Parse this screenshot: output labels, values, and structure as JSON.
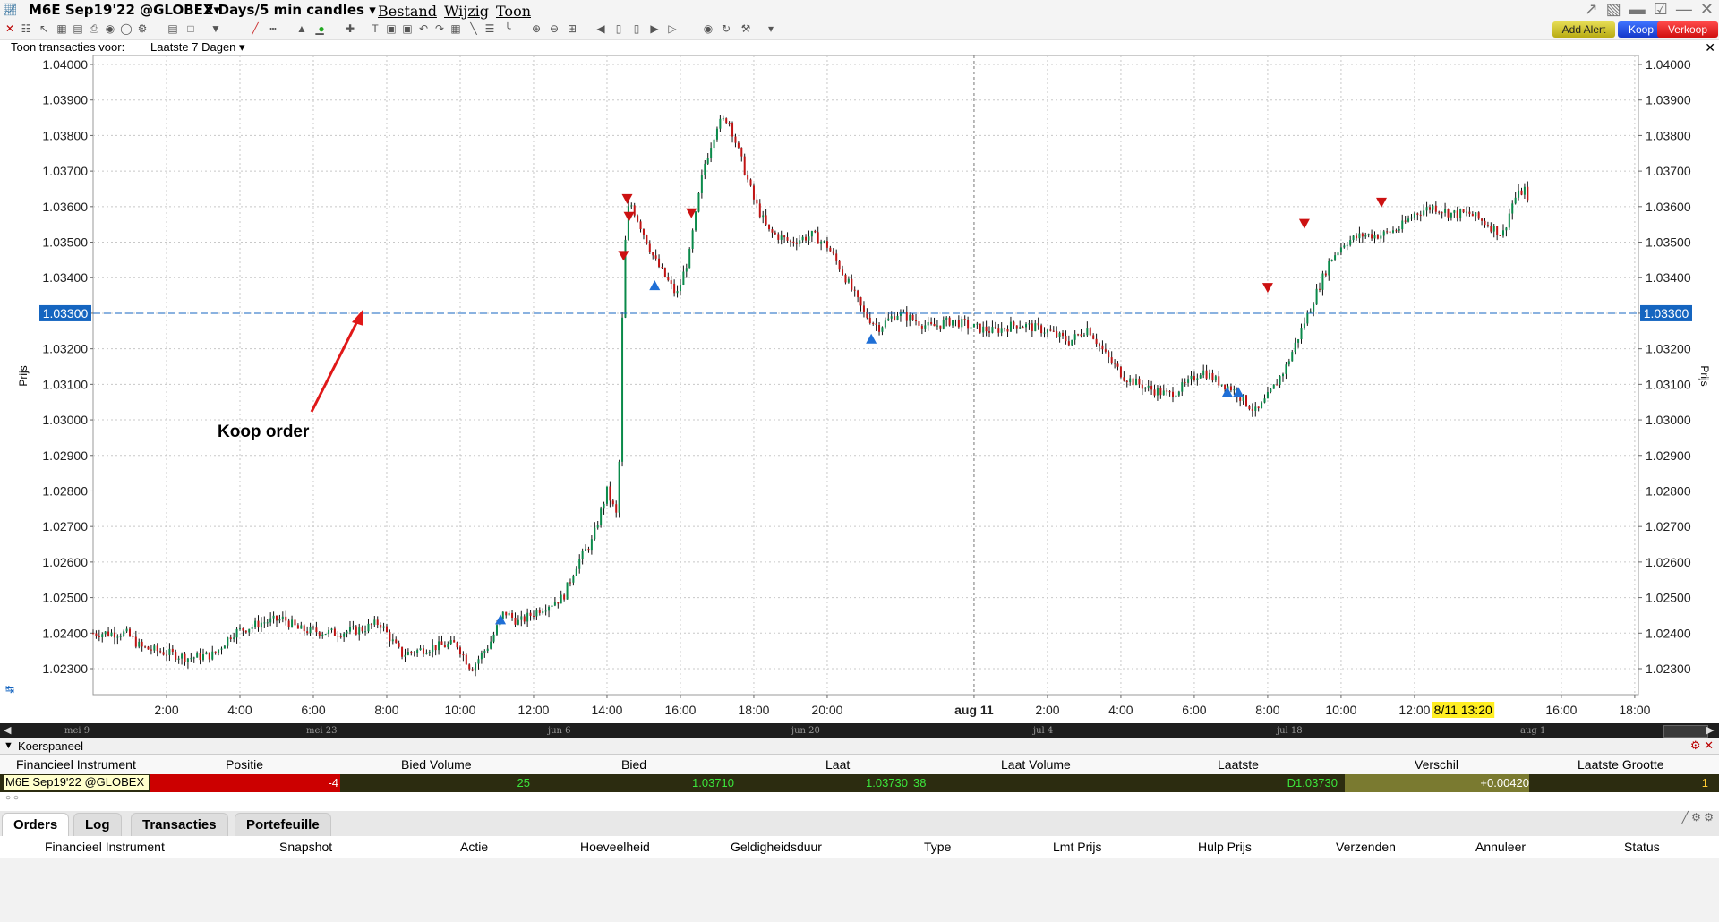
{
  "titlebar": {
    "symbol": "M6E Sep19'22 @GLOBEX",
    "period": "2 Days/5 min candles",
    "menu": [
      "Bestand",
      "Wijzig",
      "Toon"
    ]
  },
  "toolbar": {
    "add_alert": "Add Alert",
    "buy": "Koop",
    "sell": "Verkoop"
  },
  "filter": {
    "label": "Toon transacties voor:",
    "value": "Laatste 7 Dagen"
  },
  "annotation": {
    "text": "Koop order"
  },
  "chart_data": {
    "type": "candlestick",
    "ylabel": "Prijs",
    "ylim": [
      1.0225,
      1.0405
    ],
    "yticks": [
      "1.04000",
      "1.03900",
      "1.03800",
      "1.03700",
      "1.03600",
      "1.03500",
      "1.03400",
      "1.03300",
      "1.03200",
      "1.03100",
      "1.03000",
      "1.02900",
      "1.02800",
      "1.02700",
      "1.02600",
      "1.02500",
      "1.02400",
      "1.02300"
    ],
    "xticks": [
      "2:00",
      "4:00",
      "6:00",
      "8:00",
      "10:00",
      "12:00",
      "14:00",
      "16:00",
      "18:00",
      "20:00",
      "aug 11",
      "2:00",
      "4:00",
      "6:00",
      "8:00",
      "10:00",
      "12:00",
      "16:00",
      "18:00"
    ],
    "xtick_positions": [
      2,
      4,
      6,
      8,
      10,
      12,
      14,
      16,
      18,
      20,
      24,
      26,
      28,
      30,
      32,
      34,
      36,
      40,
      42
    ],
    "x_range": [
      0,
      42.1
    ],
    "order_line": {
      "price": 1.033,
      "label": "1.03300"
    },
    "time_cursor": {
      "label": "8/11 13:20",
      "x": 37.3
    },
    "path": [
      [
        0,
        1.024
      ],
      [
        0.9,
        1.024
      ],
      [
        1.3,
        1.0236
      ],
      [
        2.2,
        1.0234
      ],
      [
        2.6,
        1.0233
      ],
      [
        3.3,
        1.0234
      ],
      [
        3.8,
        1.024
      ],
      [
        4.6,
        1.0243
      ],
      [
        5.2,
        1.0244
      ],
      [
        5.6,
        1.0241
      ],
      [
        6.6,
        1.024
      ],
      [
        7.3,
        1.0241
      ],
      [
        7.8,
        1.0243
      ],
      [
        8.4,
        1.0234
      ],
      [
        9.2,
        1.0236
      ],
      [
        9.9,
        1.0237
      ],
      [
        10.3,
        1.023
      ],
      [
        10.8,
        1.0237
      ],
      [
        11.2,
        1.0246
      ],
      [
        11.6,
        1.0243
      ],
      [
        12.2,
        1.0247
      ],
      [
        12.8,
        1.025
      ],
      [
        13.2,
        1.026
      ],
      [
        13.6,
        1.0266
      ],
      [
        14.0,
        1.028
      ],
      [
        14.3,
        1.0272
      ],
      [
        14.45,
        1.0345
      ],
      [
        14.6,
        1.0362
      ],
      [
        14.9,
        1.0355
      ],
      [
        15.3,
        1.0345
      ],
      [
        15.6,
        1.034
      ],
      [
        15.9,
        1.0335
      ],
      [
        16.2,
        1.0345
      ],
      [
        16.6,
        1.037
      ],
      [
        17.0,
        1.0383
      ],
      [
        17.3,
        1.0385
      ],
      [
        17.6,
        1.0375
      ],
      [
        18.0,
        1.0362
      ],
      [
        18.4,
        1.0353
      ],
      [
        19.0,
        1.035
      ],
      [
        19.6,
        1.0352
      ],
      [
        20.0,
        1.0349
      ],
      [
        20.5,
        1.034
      ],
      [
        21.0,
        1.033
      ],
      [
        21.4,
        1.0326
      ],
      [
        21.9,
        1.033
      ],
      [
        22.4,
        1.0328
      ],
      [
        22.8,
        1.0326
      ],
      [
        23.4,
        1.0328
      ],
      [
        24.0,
        1.0326
      ],
      [
        24.5,
        1.0325
      ],
      [
        25.2,
        1.0327
      ],
      [
        26.0,
        1.0325
      ],
      [
        26.6,
        1.0322
      ],
      [
        27.1,
        1.0326
      ],
      [
        27.6,
        1.0318
      ],
      [
        28.1,
        1.0312
      ],
      [
        28.7,
        1.0309
      ],
      [
        29.3,
        1.0307
      ],
      [
        29.8,
        1.031
      ],
      [
        30.2,
        1.0314
      ],
      [
        30.6,
        1.0311
      ],
      [
        31.0,
        1.0309
      ],
      [
        31.4,
        1.0305
      ],
      [
        31.7,
        1.0302
      ],
      [
        32.1,
        1.0308
      ],
      [
        32.5,
        1.0315
      ],
      [
        32.9,
        1.0325
      ],
      [
        33.3,
        1.0335
      ],
      [
        33.7,
        1.0345
      ],
      [
        34.1,
        1.035
      ],
      [
        34.6,
        1.0352
      ],
      [
        35.1,
        1.0352
      ],
      [
        35.6,
        1.0354
      ],
      [
        36.0,
        1.0358
      ],
      [
        36.5,
        1.036
      ],
      [
        37.0,
        1.0358
      ],
      [
        37.5,
        1.0358
      ],
      [
        38.0,
        1.0355
      ],
      [
        38.4,
        1.0352
      ],
      [
        38.7,
        1.0362
      ],
      [
        39.0,
        1.0365
      ],
      [
        39.1,
        1.036
      ]
    ],
    "markers": [
      {
        "type": "sell",
        "x": 14.45,
        "y": 1.0346
      },
      {
        "type": "sell",
        "x": 14.55,
        "y": 1.0362
      },
      {
        "type": "sell",
        "x": 14.6,
        "y": 1.0357
      },
      {
        "type": "sell",
        "x": 16.3,
        "y": 1.0358
      },
      {
        "type": "sell",
        "x": 32.0,
        "y": 1.0337
      },
      {
        "type": "sell",
        "x": 33.0,
        "y": 1.0355
      },
      {
        "type": "sell",
        "x": 35.1,
        "y": 1.0361
      },
      {
        "type": "buy",
        "x": 11.1,
        "y": 1.0244
      },
      {
        "type": "buy",
        "x": 15.3,
        "y": 1.0338
      },
      {
        "type": "buy",
        "x": 21.2,
        "y": 1.0323
      },
      {
        "type": "buy",
        "x": 30.9,
        "y": 1.0308
      },
      {
        "type": "buy",
        "x": 31.2,
        "y": 1.0308
      }
    ]
  },
  "timeline": {
    "labels": [
      "mei 9",
      "mei 23",
      "jun 6",
      "jun 20",
      "jul 4",
      "jul 18",
      "aug 1"
    ]
  },
  "koerspaneel": {
    "title": "Koerspaneel",
    "columns": [
      "Financieel Instrument",
      "Positie",
      "Bied Volume",
      "Bied",
      "Laat",
      "Laat Volume",
      "Laatste",
      "Verschil",
      "Laatste Grootte"
    ],
    "row": {
      "instrument": "M6E Sep19'22 @GLOBEX",
      "positie": "-4",
      "bied_volume": "25",
      "bied": "1.03710",
      "laat": "1.03730",
      "laat_volume": "38",
      "laatste": "D1.03730",
      "verschil": "+0.00420",
      "laatste_grootte": "1"
    }
  },
  "tabs": [
    "Orders",
    "Log",
    "Transacties",
    "Portefeuille"
  ],
  "orders_columns": [
    "Financieel Instrument",
    "Snapshot",
    "Actie",
    "Hoeveelheid",
    "Geldigheidsduur",
    "Type",
    "Lmt Prijs",
    "Hulp Prijs",
    "Verzenden",
    "Annuleer",
    "Status"
  ],
  "colors": {
    "up": "#0a8a4a",
    "down": "#c01414",
    "buy_marker": "#1f6fd6",
    "sell_marker": "#cc1111",
    "accent": "#1565c0"
  }
}
